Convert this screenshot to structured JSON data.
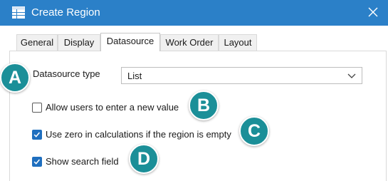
{
  "window": {
    "title": "Create Region",
    "app_icon": "table-icon",
    "close_icon": "close-icon"
  },
  "tabs": [
    {
      "label": "General",
      "active": false
    },
    {
      "label": "Display",
      "active": false
    },
    {
      "label": "Datasource",
      "active": true
    },
    {
      "label": "Work Order",
      "active": false
    },
    {
      "label": "Layout",
      "active": false
    }
  ],
  "datasource": {
    "type_label": "Datasource type",
    "type_value": "List",
    "dropdown_icon": "chevron-down-icon"
  },
  "options": [
    {
      "label": "Allow users to enter a new value",
      "checked": false
    },
    {
      "label": "Use zero in calculations if the region is empty",
      "checked": true
    },
    {
      "label": "Show search field",
      "checked": true
    }
  ],
  "callouts": [
    "A",
    "B",
    "C",
    "D"
  ],
  "colors": {
    "titlebar": "#2b80c8",
    "callout": "#1b8f98",
    "checkbox_checked": "#1f6fbf"
  }
}
